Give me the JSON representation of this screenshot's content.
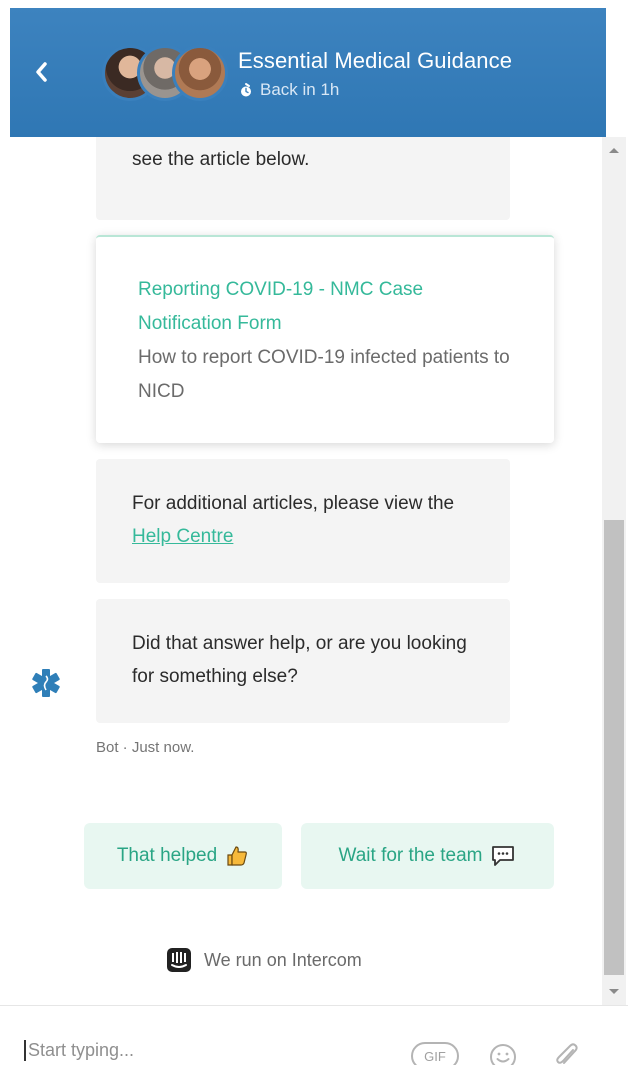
{
  "header": {
    "title": "Essential Medical Guidance",
    "status": "Back in 1h"
  },
  "messages": {
    "intro_text": "see the article below.",
    "article": {
      "title": "Reporting COVID-19 - NMC Case Notification Form",
      "description": "How to report COVID-19 infected patients to NICD"
    },
    "additional_prefix": "For additional articles, please view the ",
    "help_link": "Help Centre",
    "question": "Did that answer help, or are you looking for something else?",
    "meta": "Bot · Just now."
  },
  "replies": {
    "helped": "That helped",
    "wait": "Wait for the team"
  },
  "footer": {
    "brand": "We run on Intercom"
  },
  "composer": {
    "placeholder": "Start typing...",
    "gif_label": "GIF"
  },
  "colors": {
    "header_bg": "#3d83bf",
    "accent": "#35b99a",
    "reply_bg": "#e8f7f1",
    "bubble_bg": "#f4f4f4"
  },
  "icons": [
    "chevron-left-icon",
    "clock-icon",
    "medical-star-icon",
    "thumbs-up-icon",
    "chat-bubble-icon",
    "intercom-logo-icon",
    "emoji-icon",
    "paperclip-icon"
  ]
}
